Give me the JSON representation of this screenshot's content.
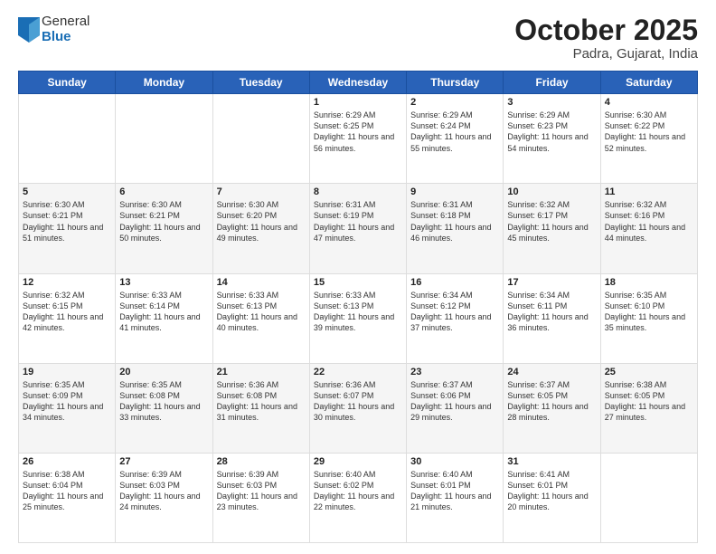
{
  "logo": {
    "general": "General",
    "blue": "Blue"
  },
  "header": {
    "title": "October 2025",
    "subtitle": "Padra, Gujarat, India"
  },
  "days_of_week": [
    "Sunday",
    "Monday",
    "Tuesday",
    "Wednesday",
    "Thursday",
    "Friday",
    "Saturday"
  ],
  "weeks": [
    [
      {
        "day": "",
        "info": ""
      },
      {
        "day": "",
        "info": ""
      },
      {
        "day": "",
        "info": ""
      },
      {
        "day": "1",
        "info": "Sunrise: 6:29 AM\nSunset: 6:25 PM\nDaylight: 11 hours and 56 minutes."
      },
      {
        "day": "2",
        "info": "Sunrise: 6:29 AM\nSunset: 6:24 PM\nDaylight: 11 hours and 55 minutes."
      },
      {
        "day": "3",
        "info": "Sunrise: 6:29 AM\nSunset: 6:23 PM\nDaylight: 11 hours and 54 minutes."
      },
      {
        "day": "4",
        "info": "Sunrise: 6:30 AM\nSunset: 6:22 PM\nDaylight: 11 hours and 52 minutes."
      }
    ],
    [
      {
        "day": "5",
        "info": "Sunrise: 6:30 AM\nSunset: 6:21 PM\nDaylight: 11 hours and 51 minutes."
      },
      {
        "day": "6",
        "info": "Sunrise: 6:30 AM\nSunset: 6:21 PM\nDaylight: 11 hours and 50 minutes."
      },
      {
        "day": "7",
        "info": "Sunrise: 6:30 AM\nSunset: 6:20 PM\nDaylight: 11 hours and 49 minutes."
      },
      {
        "day": "8",
        "info": "Sunrise: 6:31 AM\nSunset: 6:19 PM\nDaylight: 11 hours and 47 minutes."
      },
      {
        "day": "9",
        "info": "Sunrise: 6:31 AM\nSunset: 6:18 PM\nDaylight: 11 hours and 46 minutes."
      },
      {
        "day": "10",
        "info": "Sunrise: 6:32 AM\nSunset: 6:17 PM\nDaylight: 11 hours and 45 minutes."
      },
      {
        "day": "11",
        "info": "Sunrise: 6:32 AM\nSunset: 6:16 PM\nDaylight: 11 hours and 44 minutes."
      }
    ],
    [
      {
        "day": "12",
        "info": "Sunrise: 6:32 AM\nSunset: 6:15 PM\nDaylight: 11 hours and 42 minutes."
      },
      {
        "day": "13",
        "info": "Sunrise: 6:33 AM\nSunset: 6:14 PM\nDaylight: 11 hours and 41 minutes."
      },
      {
        "day": "14",
        "info": "Sunrise: 6:33 AM\nSunset: 6:13 PM\nDaylight: 11 hours and 40 minutes."
      },
      {
        "day": "15",
        "info": "Sunrise: 6:33 AM\nSunset: 6:13 PM\nDaylight: 11 hours and 39 minutes."
      },
      {
        "day": "16",
        "info": "Sunrise: 6:34 AM\nSunset: 6:12 PM\nDaylight: 11 hours and 37 minutes."
      },
      {
        "day": "17",
        "info": "Sunrise: 6:34 AM\nSunset: 6:11 PM\nDaylight: 11 hours and 36 minutes."
      },
      {
        "day": "18",
        "info": "Sunrise: 6:35 AM\nSunset: 6:10 PM\nDaylight: 11 hours and 35 minutes."
      }
    ],
    [
      {
        "day": "19",
        "info": "Sunrise: 6:35 AM\nSunset: 6:09 PM\nDaylight: 11 hours and 34 minutes."
      },
      {
        "day": "20",
        "info": "Sunrise: 6:35 AM\nSunset: 6:08 PM\nDaylight: 11 hours and 33 minutes."
      },
      {
        "day": "21",
        "info": "Sunrise: 6:36 AM\nSunset: 6:08 PM\nDaylight: 11 hours and 31 minutes."
      },
      {
        "day": "22",
        "info": "Sunrise: 6:36 AM\nSunset: 6:07 PM\nDaylight: 11 hours and 30 minutes."
      },
      {
        "day": "23",
        "info": "Sunrise: 6:37 AM\nSunset: 6:06 PM\nDaylight: 11 hours and 29 minutes."
      },
      {
        "day": "24",
        "info": "Sunrise: 6:37 AM\nSunset: 6:05 PM\nDaylight: 11 hours and 28 minutes."
      },
      {
        "day": "25",
        "info": "Sunrise: 6:38 AM\nSunset: 6:05 PM\nDaylight: 11 hours and 27 minutes."
      }
    ],
    [
      {
        "day": "26",
        "info": "Sunrise: 6:38 AM\nSunset: 6:04 PM\nDaylight: 11 hours and 25 minutes."
      },
      {
        "day": "27",
        "info": "Sunrise: 6:39 AM\nSunset: 6:03 PM\nDaylight: 11 hours and 24 minutes."
      },
      {
        "day": "28",
        "info": "Sunrise: 6:39 AM\nSunset: 6:03 PM\nDaylight: 11 hours and 23 minutes."
      },
      {
        "day": "29",
        "info": "Sunrise: 6:40 AM\nSunset: 6:02 PM\nDaylight: 11 hours and 22 minutes."
      },
      {
        "day": "30",
        "info": "Sunrise: 6:40 AM\nSunset: 6:01 PM\nDaylight: 11 hours and 21 minutes."
      },
      {
        "day": "31",
        "info": "Sunrise: 6:41 AM\nSunset: 6:01 PM\nDaylight: 11 hours and 20 minutes."
      },
      {
        "day": "",
        "info": ""
      }
    ]
  ]
}
